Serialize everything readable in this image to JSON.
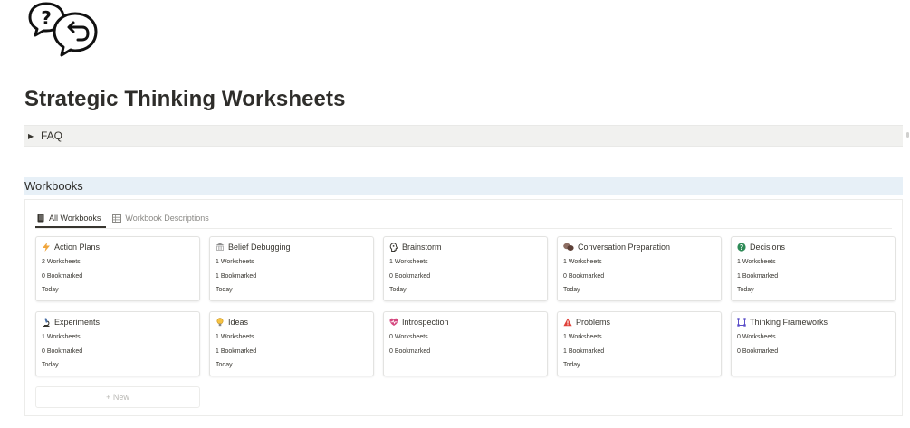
{
  "page": {
    "icon": "question-reply-bubbles-icon",
    "title": "Strategic Thinking Worksheets"
  },
  "faq": {
    "label": "FAQ"
  },
  "workbooks": {
    "heading": "Workbooks",
    "tabs": [
      {
        "label": "All Workbooks",
        "icon": "book-icon",
        "active": true
      },
      {
        "label": "Workbook Descriptions",
        "icon": "table-icon",
        "active": false
      }
    ],
    "cards": [
      {
        "name": "Action Plans",
        "icon": "lightning-icon",
        "worksheets": "2 Worksheets",
        "bookmarked": "0 Bookmarked",
        "date": "Today"
      },
      {
        "name": "Belief Debugging",
        "icon": "building-icon",
        "worksheets": "1 Worksheets",
        "bookmarked": "1 Bookmarked",
        "date": "Today"
      },
      {
        "name": "Brainstorm",
        "icon": "head-icon",
        "worksheets": "1 Worksheets",
        "bookmarked": "0 Bookmarked",
        "date": "Today"
      },
      {
        "name": "Conversation Preparation",
        "icon": "speech-bubbles-icon",
        "worksheets": "1 Worksheets",
        "bookmarked": "0 Bookmarked",
        "date": "Today"
      },
      {
        "name": "Decisions",
        "icon": "globe-question-icon",
        "worksheets": "1 Worksheets",
        "bookmarked": "1 Bookmarked",
        "date": "Today"
      },
      {
        "name": "Experiments",
        "icon": "microscope-icon",
        "worksheets": "1 Worksheets",
        "bookmarked": "0 Bookmarked",
        "date": "Today"
      },
      {
        "name": "Ideas",
        "icon": "lightbulb-icon",
        "worksheets": "1 Worksheets",
        "bookmarked": "1 Bookmarked",
        "date": "Today"
      },
      {
        "name": "Introspection",
        "icon": "heart-pulse-icon",
        "worksheets": "0 Worksheets",
        "bookmarked": "0 Bookmarked",
        "date": ""
      },
      {
        "name": "Problems",
        "icon": "warning-icon",
        "worksheets": "1 Worksheets",
        "bookmarked": "1 Bookmarked",
        "date": "Today"
      },
      {
        "name": "Thinking Frameworks",
        "icon": "frame-icon",
        "worksheets": "0 Worksheets",
        "bookmarked": "0 Bookmarked",
        "date": ""
      }
    ],
    "new_label": "+ New"
  },
  "colors": {
    "text": "#37352f",
    "faq_bg": "#f1f1ef",
    "header_bg": "#e7f0f7",
    "lightning": "#f0a53b",
    "warning": "#e0413a",
    "heart": "#d4487f",
    "frame": "#5b4ec9",
    "globe": "#2e8b57"
  }
}
